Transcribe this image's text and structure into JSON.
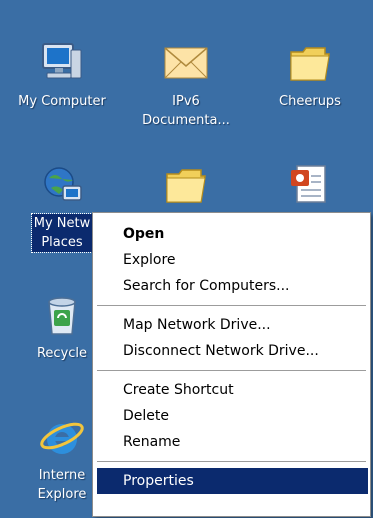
{
  "desktop": {
    "background_color": "#3A6EA5",
    "icons": [
      {
        "label": "My Computer",
        "icon": "my-computer-icon",
        "selected": false
      },
      {
        "label": "IPv6\nDocumenta...",
        "icon": "envelope-icon",
        "selected": false
      },
      {
        "label": "Cheerups",
        "icon": "folder-icon",
        "selected": false
      },
      {
        "label": "My Netw\nPlaces",
        "icon": "network-places-icon",
        "selected": true
      },
      {
        "label": "",
        "icon": "folder-icon",
        "selected": false
      },
      {
        "label": "",
        "icon": "document-icon",
        "selected": false
      },
      {
        "label": "Recycle",
        "icon": "recycle-bin-icon",
        "selected": false
      },
      {
        "label": "Interne\nExplore",
        "icon": "internet-explorer-icon",
        "selected": false
      }
    ]
  },
  "context_menu": {
    "items": [
      {
        "label": "Open",
        "default": true,
        "highlighted": false
      },
      {
        "label": "Explore",
        "default": false,
        "highlighted": false
      },
      {
        "label": "Search for Computers...",
        "default": false,
        "highlighted": false
      },
      {
        "separator": true
      },
      {
        "label": "Map Network Drive...",
        "default": false,
        "highlighted": false
      },
      {
        "label": "Disconnect Network Drive...",
        "default": false,
        "highlighted": false
      },
      {
        "separator": true
      },
      {
        "label": "Create Shortcut",
        "default": false,
        "highlighted": false
      },
      {
        "label": "Delete",
        "default": false,
        "highlighted": false
      },
      {
        "label": "Rename",
        "default": false,
        "highlighted": false
      },
      {
        "separator": true
      },
      {
        "label": "Properties",
        "default": false,
        "highlighted": true
      }
    ],
    "highlight_color": "#0B2A6E"
  }
}
